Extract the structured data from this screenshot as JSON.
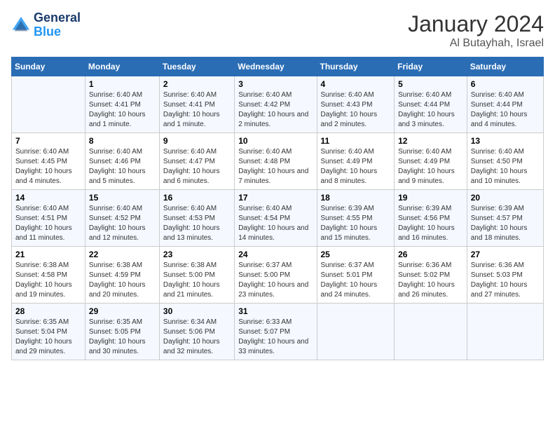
{
  "header": {
    "logo_line1": "General",
    "logo_line2": "Blue",
    "month_title": "January 2024",
    "location": "Al Butayhah, Israel"
  },
  "weekdays": [
    "Sunday",
    "Monday",
    "Tuesday",
    "Wednesday",
    "Thursday",
    "Friday",
    "Saturday"
  ],
  "weeks": [
    [
      {
        "day": "",
        "sunrise": "",
        "sunset": "",
        "daylight": ""
      },
      {
        "day": "1",
        "sunrise": "Sunrise: 6:40 AM",
        "sunset": "Sunset: 4:41 PM",
        "daylight": "Daylight: 10 hours and 1 minute."
      },
      {
        "day": "2",
        "sunrise": "Sunrise: 6:40 AM",
        "sunset": "Sunset: 4:41 PM",
        "daylight": "Daylight: 10 hours and 1 minute."
      },
      {
        "day": "3",
        "sunrise": "Sunrise: 6:40 AM",
        "sunset": "Sunset: 4:42 PM",
        "daylight": "Daylight: 10 hours and 2 minutes."
      },
      {
        "day": "4",
        "sunrise": "Sunrise: 6:40 AM",
        "sunset": "Sunset: 4:43 PM",
        "daylight": "Daylight: 10 hours and 2 minutes."
      },
      {
        "day": "5",
        "sunrise": "Sunrise: 6:40 AM",
        "sunset": "Sunset: 4:44 PM",
        "daylight": "Daylight: 10 hours and 3 minutes."
      },
      {
        "day": "6",
        "sunrise": "Sunrise: 6:40 AM",
        "sunset": "Sunset: 4:44 PM",
        "daylight": "Daylight: 10 hours and 4 minutes."
      }
    ],
    [
      {
        "day": "7",
        "sunrise": "Sunrise: 6:40 AM",
        "sunset": "Sunset: 4:45 PM",
        "daylight": "Daylight: 10 hours and 4 minutes."
      },
      {
        "day": "8",
        "sunrise": "Sunrise: 6:40 AM",
        "sunset": "Sunset: 4:46 PM",
        "daylight": "Daylight: 10 hours and 5 minutes."
      },
      {
        "day": "9",
        "sunrise": "Sunrise: 6:40 AM",
        "sunset": "Sunset: 4:47 PM",
        "daylight": "Daylight: 10 hours and 6 minutes."
      },
      {
        "day": "10",
        "sunrise": "Sunrise: 6:40 AM",
        "sunset": "Sunset: 4:48 PM",
        "daylight": "Daylight: 10 hours and 7 minutes."
      },
      {
        "day": "11",
        "sunrise": "Sunrise: 6:40 AM",
        "sunset": "Sunset: 4:49 PM",
        "daylight": "Daylight: 10 hours and 8 minutes."
      },
      {
        "day": "12",
        "sunrise": "Sunrise: 6:40 AM",
        "sunset": "Sunset: 4:49 PM",
        "daylight": "Daylight: 10 hours and 9 minutes."
      },
      {
        "day": "13",
        "sunrise": "Sunrise: 6:40 AM",
        "sunset": "Sunset: 4:50 PM",
        "daylight": "Daylight: 10 hours and 10 minutes."
      }
    ],
    [
      {
        "day": "14",
        "sunrise": "Sunrise: 6:40 AM",
        "sunset": "Sunset: 4:51 PM",
        "daylight": "Daylight: 10 hours and 11 minutes."
      },
      {
        "day": "15",
        "sunrise": "Sunrise: 6:40 AM",
        "sunset": "Sunset: 4:52 PM",
        "daylight": "Daylight: 10 hours and 12 minutes."
      },
      {
        "day": "16",
        "sunrise": "Sunrise: 6:40 AM",
        "sunset": "Sunset: 4:53 PM",
        "daylight": "Daylight: 10 hours and 13 minutes."
      },
      {
        "day": "17",
        "sunrise": "Sunrise: 6:40 AM",
        "sunset": "Sunset: 4:54 PM",
        "daylight": "Daylight: 10 hours and 14 minutes."
      },
      {
        "day": "18",
        "sunrise": "Sunrise: 6:39 AM",
        "sunset": "Sunset: 4:55 PM",
        "daylight": "Daylight: 10 hours and 15 minutes."
      },
      {
        "day": "19",
        "sunrise": "Sunrise: 6:39 AM",
        "sunset": "Sunset: 4:56 PM",
        "daylight": "Daylight: 10 hours and 16 minutes."
      },
      {
        "day": "20",
        "sunrise": "Sunrise: 6:39 AM",
        "sunset": "Sunset: 4:57 PM",
        "daylight": "Daylight: 10 hours and 18 minutes."
      }
    ],
    [
      {
        "day": "21",
        "sunrise": "Sunrise: 6:38 AM",
        "sunset": "Sunset: 4:58 PM",
        "daylight": "Daylight: 10 hours and 19 minutes."
      },
      {
        "day": "22",
        "sunrise": "Sunrise: 6:38 AM",
        "sunset": "Sunset: 4:59 PM",
        "daylight": "Daylight: 10 hours and 20 minutes."
      },
      {
        "day": "23",
        "sunrise": "Sunrise: 6:38 AM",
        "sunset": "Sunset: 5:00 PM",
        "daylight": "Daylight: 10 hours and 21 minutes."
      },
      {
        "day": "24",
        "sunrise": "Sunrise: 6:37 AM",
        "sunset": "Sunset: 5:00 PM",
        "daylight": "Daylight: 10 hours and 23 minutes."
      },
      {
        "day": "25",
        "sunrise": "Sunrise: 6:37 AM",
        "sunset": "Sunset: 5:01 PM",
        "daylight": "Daylight: 10 hours and 24 minutes."
      },
      {
        "day": "26",
        "sunrise": "Sunrise: 6:36 AM",
        "sunset": "Sunset: 5:02 PM",
        "daylight": "Daylight: 10 hours and 26 minutes."
      },
      {
        "day": "27",
        "sunrise": "Sunrise: 6:36 AM",
        "sunset": "Sunset: 5:03 PM",
        "daylight": "Daylight: 10 hours and 27 minutes."
      }
    ],
    [
      {
        "day": "28",
        "sunrise": "Sunrise: 6:35 AM",
        "sunset": "Sunset: 5:04 PM",
        "daylight": "Daylight: 10 hours and 29 minutes."
      },
      {
        "day": "29",
        "sunrise": "Sunrise: 6:35 AM",
        "sunset": "Sunset: 5:05 PM",
        "daylight": "Daylight: 10 hours and 30 minutes."
      },
      {
        "day": "30",
        "sunrise": "Sunrise: 6:34 AM",
        "sunset": "Sunset: 5:06 PM",
        "daylight": "Daylight: 10 hours and 32 minutes."
      },
      {
        "day": "31",
        "sunrise": "Sunrise: 6:33 AM",
        "sunset": "Sunset: 5:07 PM",
        "daylight": "Daylight: 10 hours and 33 minutes."
      },
      {
        "day": "",
        "sunrise": "",
        "sunset": "",
        "daylight": ""
      },
      {
        "day": "",
        "sunrise": "",
        "sunset": "",
        "daylight": ""
      },
      {
        "day": "",
        "sunrise": "",
        "sunset": "",
        "daylight": ""
      }
    ]
  ]
}
